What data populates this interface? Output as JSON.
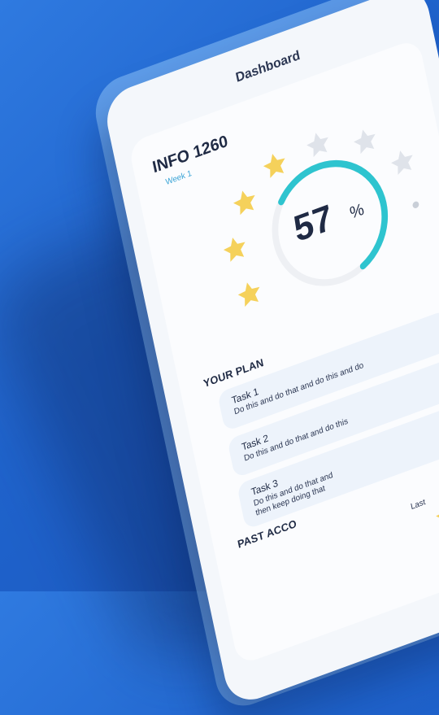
{
  "header": {
    "title": "Dashboard"
  },
  "course": {
    "name": "INFO 1260",
    "week": "Week 1"
  },
  "progress": {
    "value": 57,
    "value_text": "57",
    "unit": "%"
  },
  "stars": {
    "filled": 5,
    "total": 9,
    "filled_color": "#f5d15b",
    "empty_color": "#dfe3ea"
  },
  "colors": {
    "accent": "#2ec4cf",
    "ring_track": "#eef0f4"
  },
  "plan": {
    "title": "YOUR PLAN",
    "tasks": [
      {
        "name": "Task 1",
        "desc": "Do this and do that and do this and do"
      },
      {
        "name": "Task 2",
        "desc": "Do this and do that and do this"
      },
      {
        "name": "Task 3",
        "desc": "Do this and do that and",
        "desc2": "then keep doing that"
      }
    ]
  },
  "past": {
    "title": "PAST ACCO",
    "last_label": "Last"
  }
}
